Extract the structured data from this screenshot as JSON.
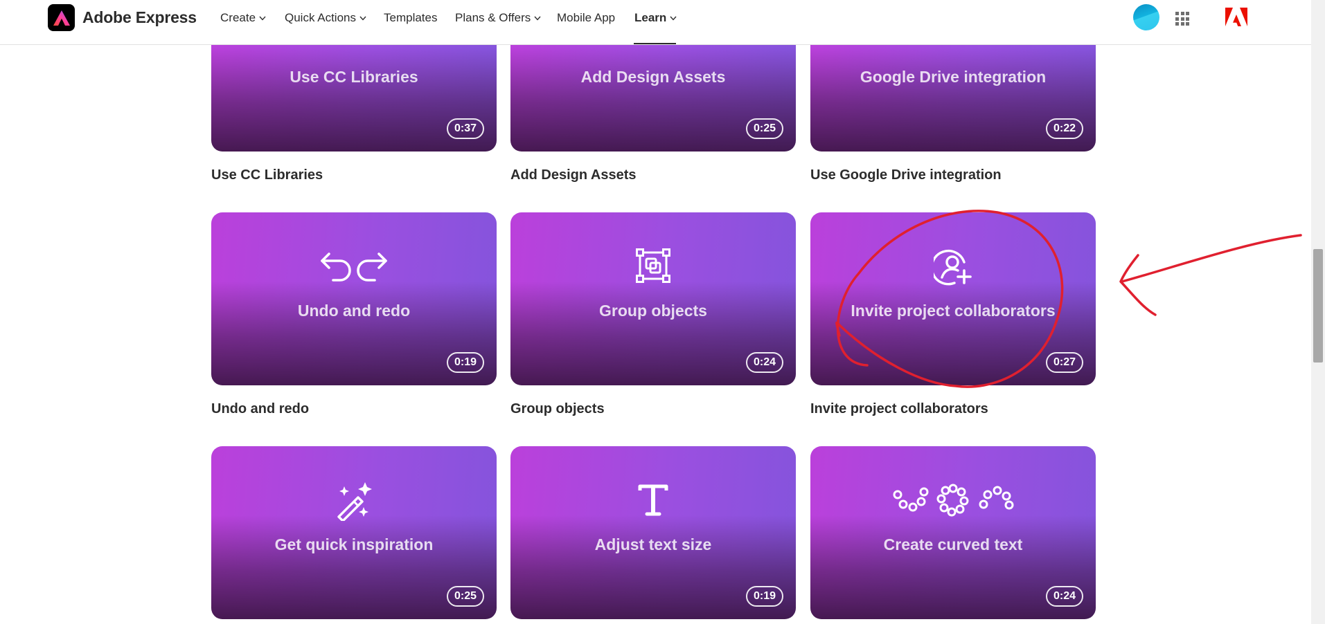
{
  "brand": {
    "name": "Adobe Express",
    "icon": "adobe-express-logo-icon"
  },
  "nav": {
    "items": [
      {
        "label": "Create",
        "dropdown": true
      },
      {
        "label": "Quick Actions",
        "dropdown": true
      },
      {
        "label": "Templates",
        "dropdown": false
      },
      {
        "label": "Plans & Offers",
        "dropdown": true
      },
      {
        "label": "Mobile App",
        "dropdown": false
      },
      {
        "label": "Learn",
        "dropdown": true,
        "active": true
      }
    ],
    "right": {
      "avatar": "avatar",
      "apps_icon": "app-switcher-grid-icon",
      "adobe_icon": "adobe-logo-icon"
    }
  },
  "tutorials": [
    {
      "title": "Use CC Libraries",
      "caption": "Use CC Libraries",
      "duration": "0:37"
    },
    {
      "title": "Add Design Assets",
      "caption": "Add Design Assets",
      "duration": "0:25"
    },
    {
      "title": "Google Drive integration",
      "caption": "Use Google Drive integration",
      "duration": "0:22"
    },
    {
      "title": "Undo and redo",
      "caption": "Undo and redo",
      "duration": "0:19",
      "icon": "undo-redo-icon"
    },
    {
      "title": "Group objects",
      "caption": "Group objects",
      "duration": "0:24",
      "icon": "group-objects-icon"
    },
    {
      "title": "Invite project collaborators",
      "caption": "Invite project collaborators",
      "duration": "0:27",
      "icon": "add-user-icon"
    },
    {
      "title": "Get quick inspiration",
      "caption": "",
      "duration": "0:25",
      "icon": "magic-wand-icon"
    },
    {
      "title": "Adjust text size",
      "caption": "",
      "duration": "0:19",
      "icon": "text-icon"
    },
    {
      "title": "Create curved text",
      "caption": "",
      "duration": "0:24",
      "icon": "curved-text-icon"
    }
  ],
  "colors": {
    "card_gradient_start": "#bb40db",
    "card_gradient_end": "#8454dc",
    "annotation_red": "#e0202f"
  }
}
